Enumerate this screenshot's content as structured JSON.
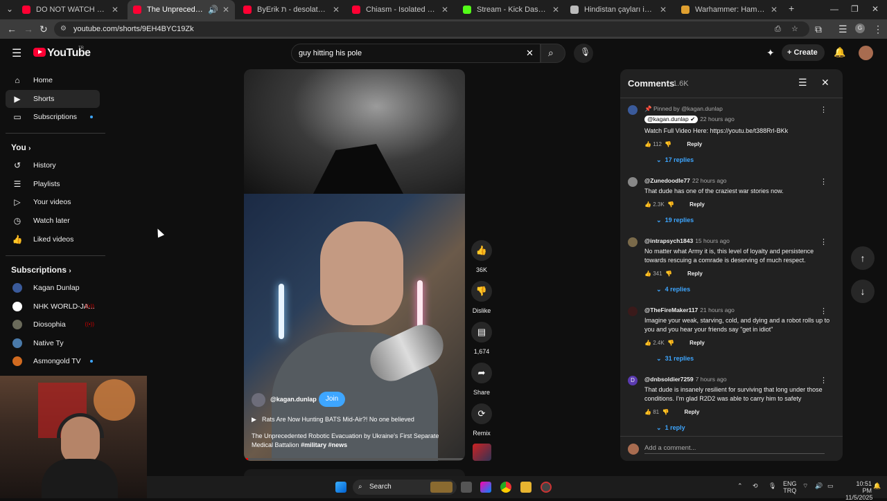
{
  "browser": {
    "tabs": [
      {
        "title": "DO NOT WATCH WHILE EATING",
        "color": "#ff0033"
      },
      {
        "title": "The Unprecedented Robotic",
        "color": "#ff0033",
        "active": true
      },
      {
        "title": "ByErik ת - desolate (Slowed) - Y",
        "color": "#ff0033"
      },
      {
        "title": "Chiasm - Isolated - YouTube",
        "color": "#ff0033"
      },
      {
        "title": "Stream - Kick Dashboard",
        "color": "#53fc18"
      },
      {
        "title": "Hindistan çayları içerikleri",
        "color": "#bbbbbb"
      },
      {
        "title": "Warhammer: Hammer and Bolt",
        "color": "#e0a030"
      }
    ],
    "url": "youtube.com/shorts/9EH4BYC19Zk"
  },
  "header": {
    "logo": "YouTube",
    "logo_tm": "TR",
    "search_value": "guy hitting his pole",
    "create_label": "Create"
  },
  "sidebar": {
    "main": [
      {
        "label": "Home",
        "icon": "⌂"
      },
      {
        "label": "Shorts",
        "icon": "▶"
      },
      {
        "label": "Subscriptions",
        "icon": "▭"
      }
    ],
    "you_heading": "You",
    "you_items": [
      {
        "label": "History",
        "icon": "↺"
      },
      {
        "label": "Playlists",
        "icon": "☰"
      },
      {
        "label": "Your videos",
        "icon": "▷"
      },
      {
        "label": "Watch later",
        "icon": "◷"
      },
      {
        "label": "Liked videos",
        "icon": "👍"
      }
    ],
    "subs_heading": "Subscriptions",
    "subs": [
      {
        "label": "Kagan Dunlap",
        "color": "#3a5a9a"
      },
      {
        "label": "NHK WORLD-JA...",
        "color": "#ffffff"
      },
      {
        "label": "Diosophia",
        "color": "#6a6a5a"
      },
      {
        "label": "Native Ty",
        "color": "#4a7aaa"
      },
      {
        "label": "Asmongold TV",
        "color": "#d06a20"
      }
    ]
  },
  "video": {
    "channel": "@kagan.dunlap",
    "join_label": "Join",
    "audio_title": "Rats Are Now Hunting BATS Mid-Air?! No one believed",
    "description": "The Unprecedented Robotic Evacuation by Ukraine's First Separate Medical Battalion",
    "tags": "#military #news",
    "progress": 0.02
  },
  "actions": {
    "likes": "36K",
    "dislike_label": "Dislike",
    "comments": "1,674",
    "share_label": "Share",
    "remix_label": "Remix"
  },
  "comments": {
    "title": "Comments",
    "count": "1.6K",
    "add_placeholder": "Add a comment...",
    "items": [
      {
        "pinned_label": "Pinned by @kagan.dunlap",
        "author": "@kagan.dunlap",
        "ago": "22 hours ago",
        "text": "Watch Full Video Here: https://youtu.be/t388Rrl-BKk",
        "likes": "112",
        "replies": "17 replies",
        "color": "#3a5a9a"
      },
      {
        "author": "@Zunedoodle77",
        "ago": "22 hours ago",
        "text": "That dude has one of the craziest war stories now.",
        "likes": "2.3K",
        "replies": "19 replies",
        "color": "#888888"
      },
      {
        "author": "@intrapsych1843",
        "ago": "15 hours ago",
        "text": "No matter what Army it is, this level of loyalty and persistence towards rescuing a comrade is deserving of much respect.",
        "likes": "341",
        "replies": "4 replies",
        "color": "#7a6a4a"
      },
      {
        "author": "@TheFireMaker117",
        "ago": "21 hours ago",
        "text": "Imagine your weak, starving, cold, and dying and a robot rolls up to you and you hear your friends say \"get in idiot\"",
        "likes": "2.4K",
        "replies": "31 replies",
        "color": "#3a1a1a"
      },
      {
        "author": "@dnbsoldier7259",
        "ago": "7 hours ago",
        "text": "That dude is insanely resilient for surviving that long under those conditions.  I'm glad R2D2 was able to carry him to safety",
        "likes": "81",
        "replies": "1 reply",
        "color": "#5a3ab0",
        "initial": "D"
      }
    ],
    "reply_label": "Reply"
  },
  "taskbar": {
    "search_label": "Search",
    "lang_1": "ENG",
    "lang_2": "TRQ",
    "time": "10:51 PM",
    "date": "11/5/2025"
  }
}
